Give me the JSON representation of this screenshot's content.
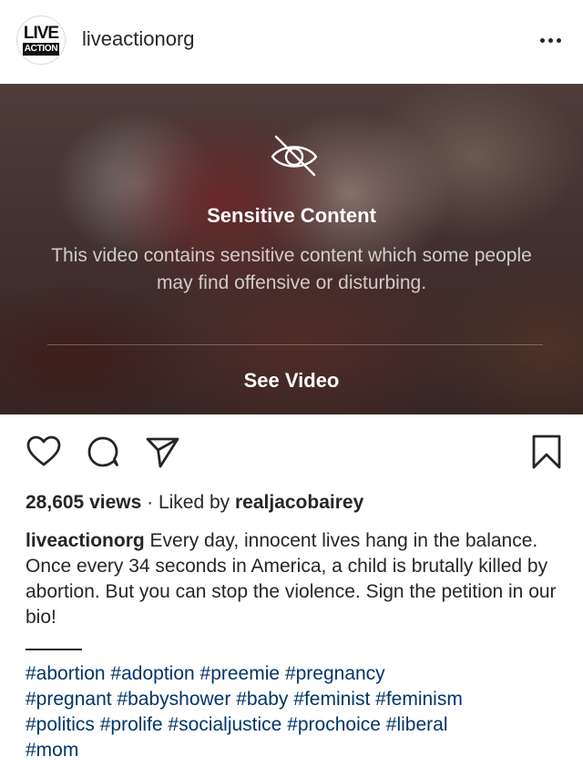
{
  "header": {
    "avatar_logo_top": "LIVE",
    "avatar_logo_bottom": "ACTION",
    "username": "liveactionorg",
    "more_icon": "more-dots-icon"
  },
  "media": {
    "icon": "eye-slash-icon",
    "title": "Sensitive Content",
    "description": "This video contains sensitive content which some people may find offensive or disturbing.",
    "see_video_label": "See Video"
  },
  "actions": {
    "like_icon": "heart-icon",
    "comment_icon": "comment-icon",
    "share_icon": "paper-plane-icon",
    "save_icon": "bookmark-icon"
  },
  "stats": {
    "views": "28,605 views",
    "separator": " · Liked by ",
    "liked_by": "realjacobairey"
  },
  "caption": {
    "username": "liveactionorg",
    "text": " Every day, innocent lives hang in the balance. Once every 34 seconds in America, a child is brutally killed by abortion. But you can stop the violence. Sign the petition in our bio!"
  },
  "hashtags": [
    "#abortion",
    "#adoption",
    "#preemie",
    "#pregnancy",
    "#pregnant",
    "#babyshower",
    "#baby",
    "#feminist",
    "#feminism",
    "#politics",
    "#prolife",
    "#socialjustice",
    "#prochoice",
    "#liberal",
    "#mom"
  ],
  "colors": {
    "text": "#262626",
    "hashtag": "#003569",
    "overlay_text": "#ffffff"
  }
}
